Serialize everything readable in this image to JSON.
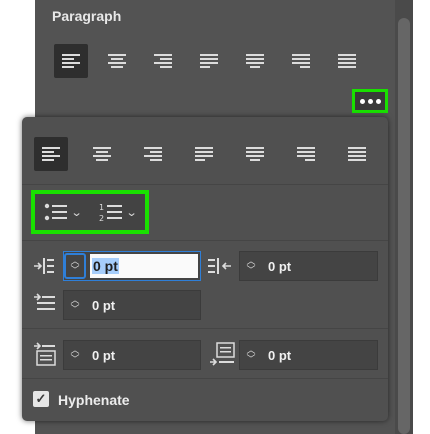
{
  "panel": {
    "title": "Paragraph"
  },
  "popover": {
    "first_line_indent": {
      "value": "0 pt"
    },
    "left_indent": {
      "value": "0 pt"
    },
    "right_indent": {
      "value": "0 pt"
    },
    "space_before": {
      "value": "0 pt"
    },
    "space_after": {
      "value": "0 pt"
    },
    "hyphenate": {
      "label": "Hyphenate",
      "checked": true
    }
  },
  "colors": {
    "highlight": "#19e000",
    "panel": "#535353",
    "focus": "#2f7fd8"
  }
}
